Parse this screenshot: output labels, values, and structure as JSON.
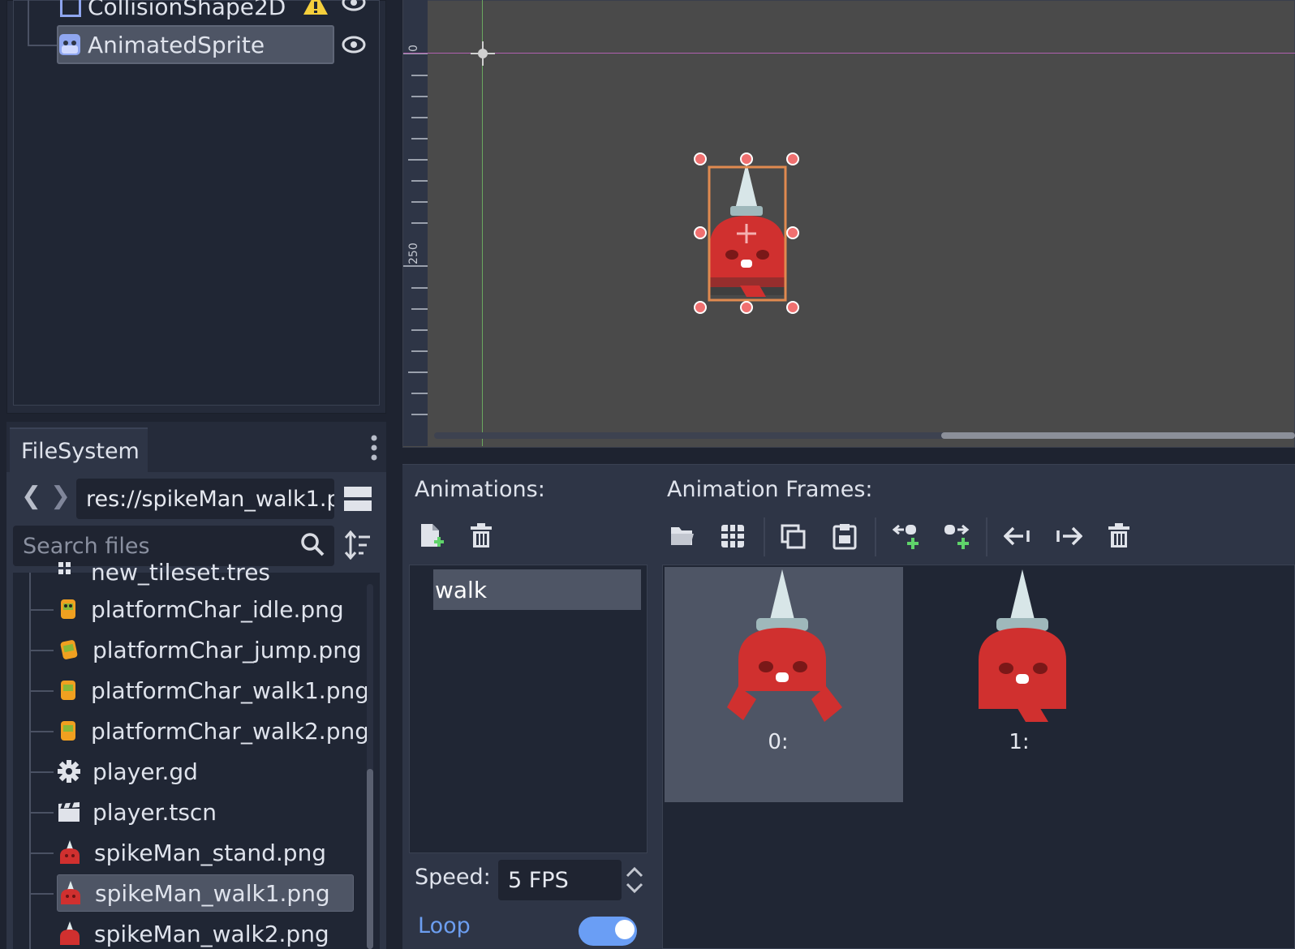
{
  "scene_tree": {
    "items": [
      {
        "label": "CollisionShape2D",
        "icon": "collision-shape-icon",
        "warning": true
      },
      {
        "label": "AnimatedSprite",
        "icon": "animated-sprite-icon",
        "selected": true
      }
    ]
  },
  "filesystem": {
    "tab_label": "FileSystem",
    "path": "res://spikeMan_walk1.p",
    "search_placeholder": "Search files",
    "files": [
      {
        "label": "new_tileset.tres",
        "icon": "tileset-icon"
      },
      {
        "label": "platformChar_idle.png",
        "icon": "image-icon"
      },
      {
        "label": "platformChar_jump.png",
        "icon": "image-icon"
      },
      {
        "label": "platformChar_walk1.png",
        "icon": "image-icon"
      },
      {
        "label": "platformChar_walk2.png",
        "icon": "image-icon"
      },
      {
        "label": "player.gd",
        "icon": "gear-icon"
      },
      {
        "label": "player.tscn",
        "icon": "scene-icon"
      },
      {
        "label": "spikeMan_stand.png",
        "icon": "spikeman-icon"
      },
      {
        "label": "spikeMan_walk1.png",
        "icon": "spikeman-icon",
        "selected": true
      },
      {
        "label": "spikeMan_walk2.png",
        "icon": "spikeman-icon"
      }
    ]
  },
  "viewport": {
    "ruler_labels": [
      "0",
      "250"
    ]
  },
  "sprite_frames": {
    "animations_label": "Animations:",
    "frames_label": "Animation Frames:",
    "animations": [
      {
        "label": "walk",
        "selected": true
      }
    ],
    "frames": [
      {
        "label": "0:",
        "selected": true
      },
      {
        "label": "1:",
        "selected": false
      }
    ],
    "speed_label": "Speed:",
    "speed_value": "5 FPS",
    "loop_label": "Loop",
    "loop_enabled": true
  },
  "colors": {
    "accent": "#6a9ef5",
    "sprite_red": "#d0302f",
    "selection_handle": "#f07070",
    "warning": "#f5cf3c"
  }
}
